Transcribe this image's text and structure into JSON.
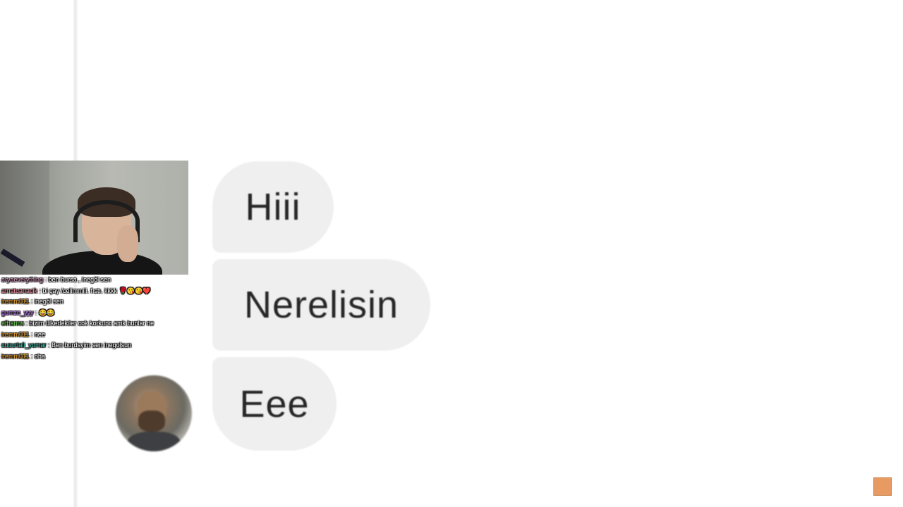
{
  "conversation": {
    "messages": [
      {
        "text": "Hiii"
      },
      {
        "text": "Nerelisin"
      },
      {
        "text": "Eee"
      }
    ]
  },
  "stream_overlay": {
    "chat": [
      {
        "user": "aryaeverything",
        "color": "#e0a0c8",
        "message": "ben bursa , inegöl sen"
      },
      {
        "user": "amatuanacik",
        "color": "#ff9aa8",
        "message": "bi çay /celimmiii. fıstı. kkkk 🌹😘😘❤️"
      },
      {
        "user": "iremm011",
        "color": "#f5a623",
        "message": "inegöl sen"
      },
      {
        "user": "gumze_yyy",
        "color": "#c77dff",
        "message": "😂😂"
      },
      {
        "user": "efhanns",
        "color": "#66d14a",
        "message": "bizim ülkedekiler cok korkunc amk bunlar ne"
      },
      {
        "user": "iremm011",
        "color": "#f5a623",
        "message": "nee"
      },
      {
        "user": "cucurtali_yumar",
        "color": "#35c4b0",
        "message": "Ben burdsyim sen inegolsun"
      },
      {
        "user": "iremm011",
        "color": "#f5a623",
        "message": "oha"
      }
    ]
  },
  "icons": {
    "avatar": "contact-avatar",
    "webcam": "streamer-webcam",
    "corner_logo": "channel-logo"
  }
}
